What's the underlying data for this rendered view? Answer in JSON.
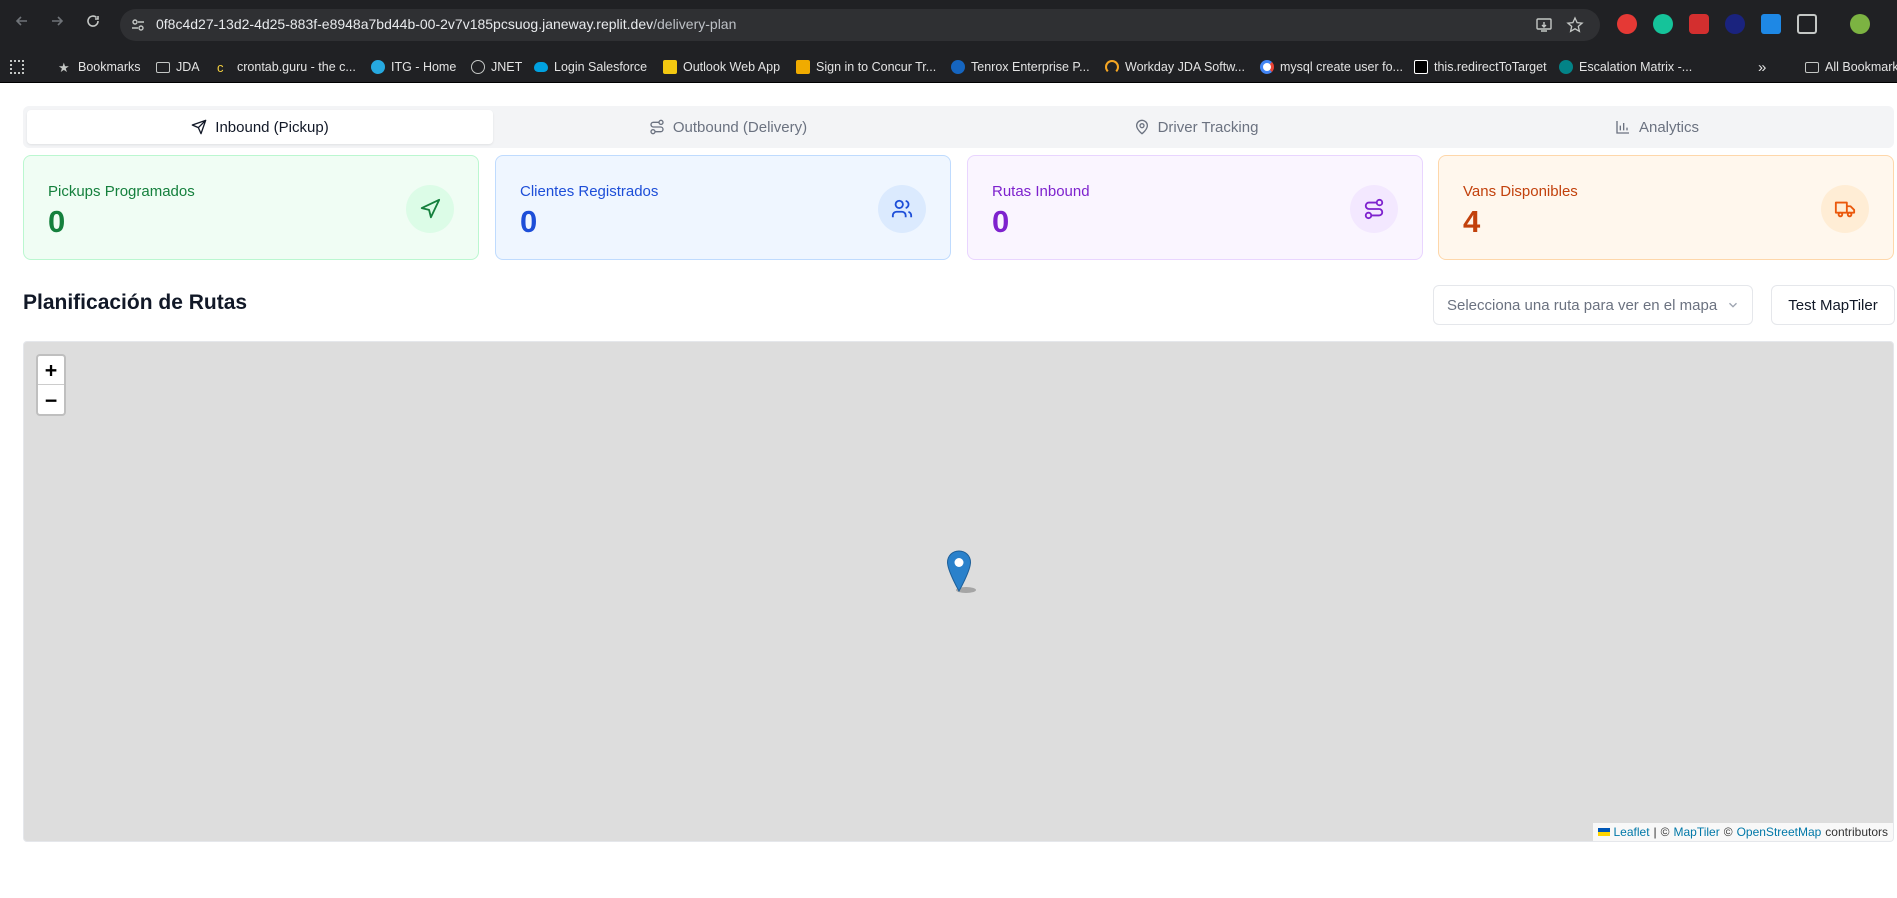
{
  "browser": {
    "url_host": "0f8c4d27-13d2-4d25-883f-e8948a7bd44b-00-2v7v185pcsuog.janeway.replit.dev",
    "url_path": "/delivery-plan",
    "bookmarks": [
      {
        "label": "Bookmarks",
        "icon": "star-icon"
      },
      {
        "label": "JDA",
        "icon": "folder-icon"
      },
      {
        "label": "crontab.guru - the c...",
        "icon": "crontab-icon"
      },
      {
        "label": "ITG - Home",
        "icon": "itg-icon"
      },
      {
        "label": "JNET",
        "icon": "globe-icon"
      },
      {
        "label": "Login Salesforce",
        "icon": "salesforce-icon"
      },
      {
        "label": "Outlook Web App",
        "icon": "outlook-icon"
      },
      {
        "label": "Sign in to Concur Tr...",
        "icon": "concur-icon"
      },
      {
        "label": "Tenrox Enterprise P...",
        "icon": "tenrox-icon"
      },
      {
        "label": "Workday JDA Softw...",
        "icon": "workday-icon"
      },
      {
        "label": "mysql create user fo...",
        "icon": "google-icon"
      },
      {
        "label": "this.redirectToTarget",
        "icon": "medium-icon"
      },
      {
        "label": "Escalation Matrix -...",
        "icon": "sharepoint-icon"
      }
    ],
    "overflow_label": "»",
    "all_bookmarks": "All Bookmarks"
  },
  "tabs": [
    {
      "label": "Inbound (Pickup)",
      "icon": "send-icon",
      "active": true
    },
    {
      "label": "Outbound (Delivery)",
      "icon": "route-icon",
      "active": false
    },
    {
      "label": "Driver Tracking",
      "icon": "map-pin-icon",
      "active": false
    },
    {
      "label": "Analytics",
      "icon": "bar-chart-icon",
      "active": false
    }
  ],
  "stats": [
    {
      "label": "Pickups Programados",
      "value": "0",
      "icon": "send-icon",
      "color": "#15803d"
    },
    {
      "label": "Clientes Registrados",
      "value": "0",
      "icon": "users-icon",
      "color": "#1d4ed8"
    },
    {
      "label": "Rutas Inbound",
      "value": "0",
      "icon": "route-icon",
      "color": "#7e22ce"
    },
    {
      "label": "Vans Disponibles",
      "value": "4",
      "icon": "truck-icon",
      "color": "#c2410c"
    }
  ],
  "planning": {
    "title": "Planificación de Rutas",
    "route_placeholder": "Selecciona una ruta para ver en el mapa",
    "test_button": "Test MapTiler"
  },
  "map": {
    "zoom_in": "+",
    "zoom_out": "−",
    "attribution": {
      "leaflet": "Leaflet",
      "sep": "|",
      "copy1": "©",
      "maptiler": "MapTiler",
      "copy2": "©",
      "osm": "OpenStreetMap",
      "contributors": "contributors"
    }
  }
}
